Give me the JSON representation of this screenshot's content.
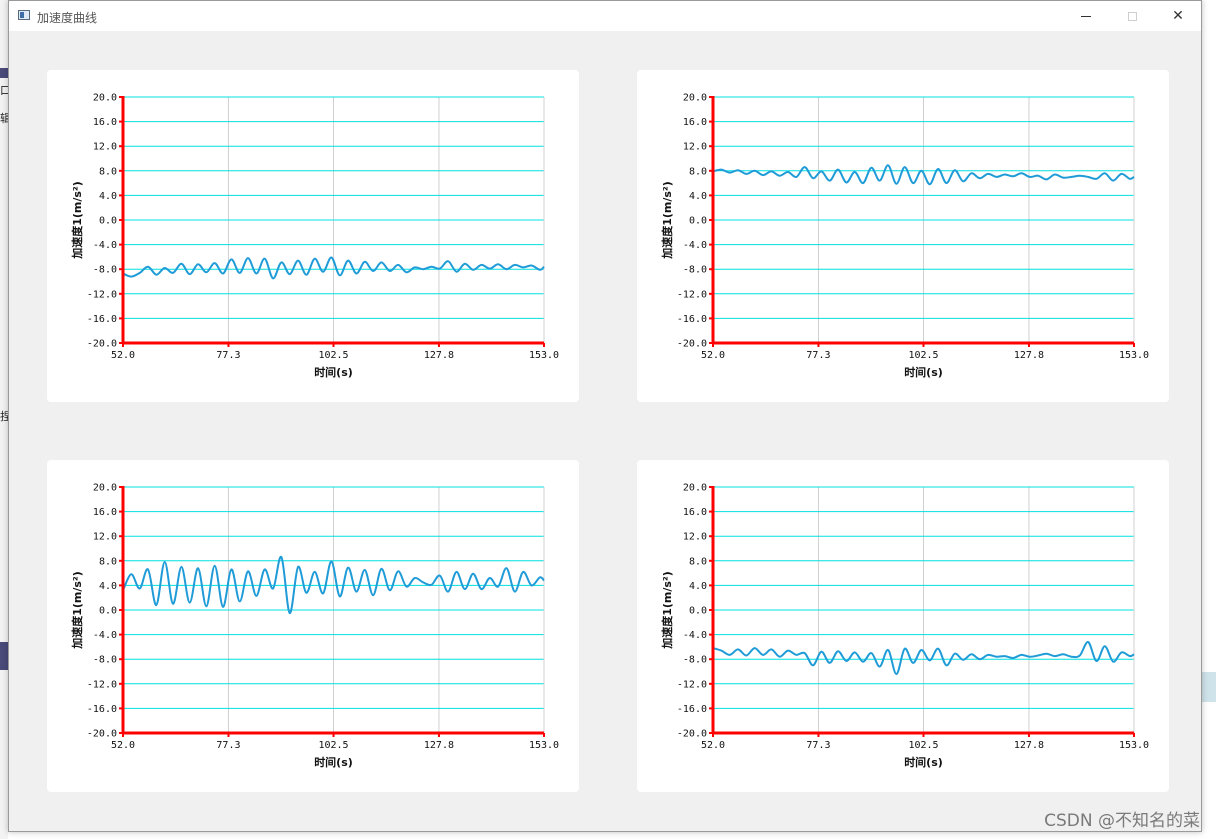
{
  "window": {
    "title": "加速度曲线"
  },
  "background_glyphs": [
    "口",
    "辑",
    "捏"
  ],
  "watermark": "CSDN @不知名的菜",
  "style": {
    "line_color": "#1f9bd7",
    "axis_color": "#ff0000",
    "grid_color": "#00e0e0",
    "vgrid_color": "#d0d0d0"
  },
  "chart_data": [
    {
      "type": "line",
      "xlabel": "时间(s)",
      "ylabel": "加速度1(m/s²)",
      "xlim": [
        52.0,
        153.0
      ],
      "ylim": [
        -20.0,
        20.0
      ],
      "xticks": [
        "52.0",
        "77.3",
        "102.5",
        "127.8",
        "153.0"
      ],
      "yticks": [
        "20.0",
        "16.0",
        "12.0",
        "8.0",
        "4.0",
        "0.0",
        "-4.0",
        "-8.0",
        "-12.0",
        "-16.0",
        "-20.0"
      ],
      "series": [
        {
          "x": [
            52,
            54,
            56,
            58,
            60,
            62,
            64,
            66,
            68,
            70,
            72,
            74,
            76,
            78,
            80,
            82,
            84,
            86,
            88,
            90,
            92,
            94,
            96,
            98,
            100,
            102,
            104,
            106,
            108,
            110,
            112,
            114,
            116,
            118,
            120,
            122,
            124,
            126,
            128,
            130,
            132,
            134,
            136,
            138,
            140,
            142,
            144,
            146,
            148,
            150,
            152,
            153
          ],
          "values": [
            -8.7,
            -9.2,
            -8.6,
            -7.6,
            -8.9,
            -7.8,
            -8.6,
            -7.1,
            -8.8,
            -7.2,
            -8.5,
            -7.0,
            -8.7,
            -6.4,
            -8.6,
            -6.2,
            -8.7,
            -6.3,
            -9.5,
            -6.9,
            -8.8,
            -6.6,
            -8.9,
            -6.3,
            -8.4,
            -6.1,
            -9.0,
            -6.6,
            -8.7,
            -6.8,
            -8.3,
            -6.9,
            -8.3,
            -7.3,
            -8.5,
            -7.7,
            -8.0,
            -7.6,
            -7.9,
            -6.7,
            -8.4,
            -7.1,
            -8.1,
            -7.3,
            -7.9,
            -7.2,
            -8.0,
            -7.3,
            -7.7,
            -7.4,
            -8.1,
            -7.6
          ]
        }
      ]
    },
    {
      "type": "line",
      "xlabel": "时间(s)",
      "ylabel": "加速度1(m/s²)",
      "xlim": [
        52.0,
        153.0
      ],
      "ylim": [
        -20.0,
        20.0
      ],
      "xticks": [
        "52.0",
        "77.3",
        "102.5",
        "127.8",
        "153.0"
      ],
      "yticks": [
        "20.0",
        "16.0",
        "12.0",
        "8.0",
        "4.0",
        "0.0",
        "-4.0",
        "-8.0",
        "-12.0",
        "-16.0",
        "-20.0"
      ],
      "series": [
        {
          "x": [
            52,
            54,
            56,
            58,
            60,
            62,
            64,
            66,
            68,
            70,
            72,
            74,
            76,
            78,
            80,
            82,
            84,
            86,
            88,
            90,
            92,
            94,
            96,
            98,
            100,
            102,
            104,
            106,
            108,
            110,
            112,
            114,
            116,
            118,
            120,
            122,
            124,
            126,
            128,
            130,
            132,
            134,
            136,
            138,
            140,
            142,
            144,
            146,
            148,
            150,
            152,
            153
          ],
          "values": [
            7.9,
            8.2,
            7.7,
            8.1,
            7.5,
            8.0,
            7.3,
            7.9,
            7.2,
            7.8,
            7.0,
            8.6,
            6.8,
            7.9,
            6.4,
            8.2,
            6.1,
            7.8,
            6.0,
            8.5,
            6.4,
            8.9,
            5.9,
            8.6,
            6.0,
            8.0,
            5.8,
            8.3,
            6.0,
            8.1,
            6.3,
            7.6,
            6.8,
            7.5,
            7.0,
            7.4,
            7.1,
            7.6,
            7.0,
            7.2,
            6.6,
            7.4,
            6.9,
            7.0,
            7.2,
            7.0,
            6.7,
            7.6,
            6.4,
            7.5,
            6.7,
            7.0
          ]
        }
      ]
    },
    {
      "type": "line",
      "xlabel": "时间(s)",
      "ylabel": "加速度1(m/s²)",
      "xlim": [
        52.0,
        153.0
      ],
      "ylim": [
        -20.0,
        20.0
      ],
      "xticks": [
        "52.0",
        "77.3",
        "102.5",
        "127.8",
        "153.0"
      ],
      "yticks": [
        "20.0",
        "16.0",
        "12.0",
        "8.0",
        "4.0",
        "0.0",
        "-4.0",
        "-8.0",
        "-12.0",
        "-16.0",
        "-20.0"
      ],
      "series": [
        {
          "x": [
            52,
            54,
            56,
            58,
            60,
            62,
            64,
            66,
            68,
            70,
            72,
            74,
            76,
            78,
            80,
            82,
            84,
            86,
            88,
            90,
            92,
            94,
            96,
            98,
            100,
            102,
            104,
            106,
            108,
            110,
            112,
            114,
            116,
            118,
            120,
            122,
            124,
            126,
            128,
            130,
            132,
            134,
            136,
            138,
            140,
            142,
            144,
            146,
            148,
            150,
            152,
            153
          ],
          "values": [
            3.2,
            5.8,
            3.5,
            6.6,
            0.8,
            7.8,
            1.0,
            7.0,
            1.2,
            6.8,
            0.6,
            7.2,
            0.5,
            6.6,
            1.4,
            6.3,
            2.3,
            6.6,
            3.5,
            8.6,
            -0.5,
            7.0,
            2.8,
            6.2,
            2.7,
            7.9,
            2.2,
            6.9,
            3.0,
            6.5,
            2.4,
            6.7,
            3.2,
            6.3,
            3.8,
            5.2,
            4.5,
            4.1,
            5.6,
            3.0,
            6.2,
            3.4,
            5.9,
            3.4,
            5.2,
            3.8,
            6.8,
            3.0,
            6.2,
            4.0,
            5.3,
            4.8
          ]
        }
      ]
    },
    {
      "type": "line",
      "xlabel": "时间(s)",
      "ylabel": "加速度1(m/s²)",
      "xlim": [
        52.0,
        153.0
      ],
      "ylim": [
        -20.0,
        20.0
      ],
      "xticks": [
        "52.0",
        "77.3",
        "102.5",
        "127.8",
        "153.0"
      ],
      "yticks": [
        "20.0",
        "16.0",
        "12.0",
        "8.0",
        "4.0",
        "0.0",
        "-4.0",
        "-8.0",
        "-12.0",
        "-16.0",
        "-20.0"
      ],
      "series": [
        {
          "x": [
            52,
            54,
            56,
            58,
            60,
            62,
            64,
            66,
            68,
            70,
            72,
            74,
            76,
            78,
            80,
            82,
            84,
            86,
            88,
            90,
            92,
            94,
            96,
            98,
            100,
            102,
            104,
            106,
            108,
            110,
            112,
            114,
            116,
            118,
            120,
            122,
            124,
            126,
            128,
            130,
            132,
            134,
            136,
            138,
            140,
            142,
            144,
            146,
            148,
            150,
            152,
            153
          ],
          "values": [
            -6.2,
            -6.6,
            -7.3,
            -6.4,
            -7.4,
            -6.2,
            -7.3,
            -6.4,
            -7.6,
            -6.6,
            -7.3,
            -7.0,
            -9.0,
            -6.8,
            -8.6,
            -6.7,
            -8.3,
            -6.9,
            -8.4,
            -7.0,
            -9.2,
            -6.5,
            -10.4,
            -6.3,
            -8.6,
            -6.5,
            -8.2,
            -6.3,
            -9.0,
            -7.1,
            -8.1,
            -7.2,
            -8.0,
            -7.3,
            -7.6,
            -7.5,
            -7.8,
            -7.3,
            -7.6,
            -7.4,
            -7.1,
            -7.5,
            -7.2,
            -7.6,
            -7.4,
            -5.2,
            -8.3,
            -5.9,
            -8.4,
            -6.9,
            -7.5,
            -7.2
          ]
        }
      ]
    }
  ]
}
